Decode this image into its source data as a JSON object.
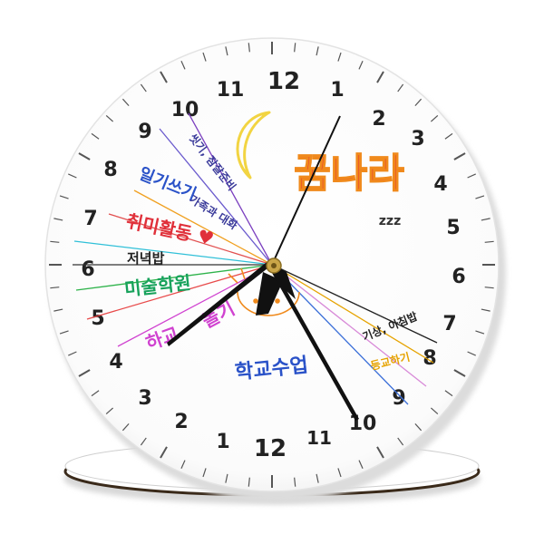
{
  "clock": {
    "top_ring_numbers": [
      "12",
      "1",
      "2",
      "3",
      "4",
      "5",
      "6",
      "7",
      "8",
      "9",
      "10",
      "11"
    ],
    "bottom_ring_numbers": [
      "12",
      "1",
      "2",
      "3",
      "4",
      "5",
      "6",
      "7",
      "8",
      "9",
      "10",
      "11"
    ],
    "title": "꿈나라",
    "zzz": "zzz",
    "schedule_labels": [
      {
        "text": "씻기, 잠잘준비",
        "color": "#3a3a9a"
      },
      {
        "text": "일기쓰기",
        "color": "#2a52c8"
      },
      {
        "text": "가족과 대화",
        "color": "#3a3a9a"
      },
      {
        "text": "취미활동 ♥",
        "color": "#e0303a"
      },
      {
        "text": "저녁밥",
        "color": "#222222"
      },
      {
        "text": "미술학원",
        "color": "#17a25b"
      },
      {
        "text": "하교",
        "color": "#d042d0"
      },
      {
        "text": "놀기",
        "color": "#d042d0"
      },
      {
        "text": "학교수업",
        "color": "#2a52c8"
      },
      {
        "text": "기상, 아침밥",
        "color": "#222222"
      },
      {
        "text": "등교하기",
        "color": "#e6a300"
      }
    ],
    "title_colors": [
      "#e8472f",
      "#f08a1c",
      "#2db34a",
      "#3b6fd8",
      "#8a3fc7"
    ],
    "moon_color": "#f2d442",
    "clock_face_color": "#ffffff",
    "stand_color": "#ffffff"
  }
}
